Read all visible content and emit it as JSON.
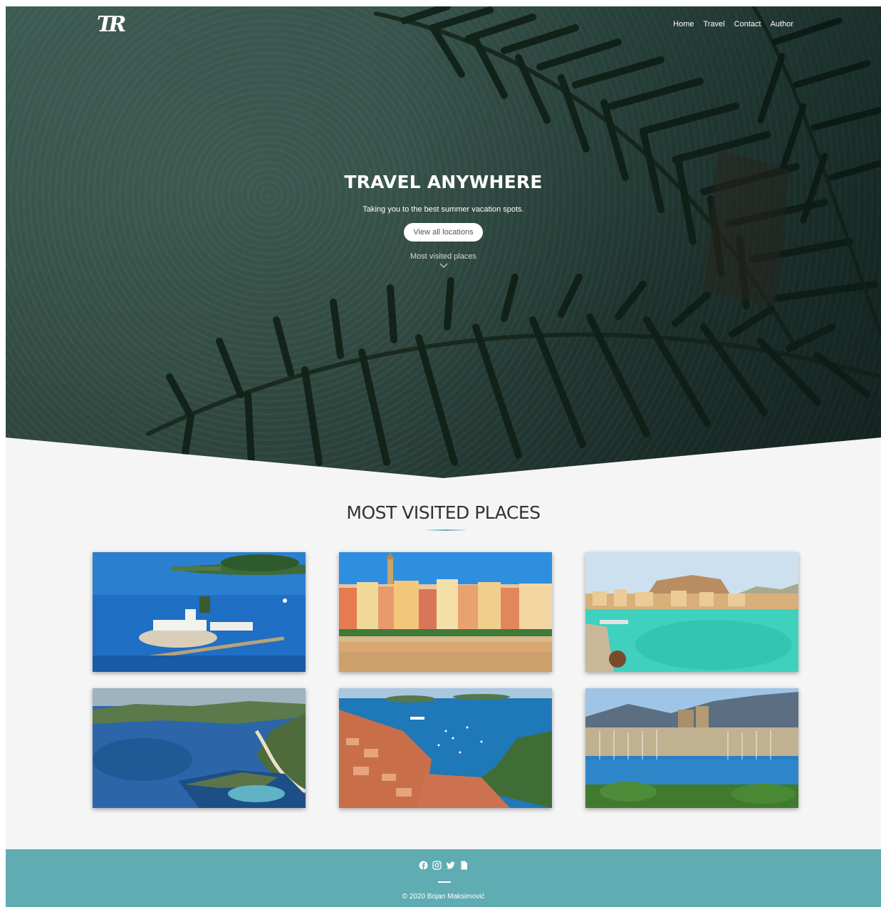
{
  "nav": {
    "logo": "TR",
    "links": [
      "Home",
      "Travel",
      "Contact",
      "Author"
    ]
  },
  "hero": {
    "title": "TRAVEL ANYWHERE",
    "subtitle": "Taking you to the best summer vacation spots.",
    "button": "View all locations",
    "scroll_hint": "Most visited places",
    "scroll_icon": "chevron-down-icon"
  },
  "section": {
    "title": "MOST VISITED PLACES"
  },
  "places": [
    {
      "scene": "island-monastery"
    },
    {
      "scene": "colorful-coastal-town"
    },
    {
      "scene": "turquoise-bay-fortress"
    },
    {
      "scene": "aerial-coastline"
    },
    {
      "scene": "harbor-town-aerial"
    },
    {
      "scene": "marina-castle"
    }
  ],
  "footer": {
    "icons": [
      "facebook-icon",
      "instagram-icon",
      "twitter-icon",
      "document-icon"
    ],
    "copyright": "© 2020 Bojan Maksimović"
  },
  "colors": {
    "accent": "#5fadb2",
    "background": "#f5f5f5",
    "title": "#333333"
  }
}
